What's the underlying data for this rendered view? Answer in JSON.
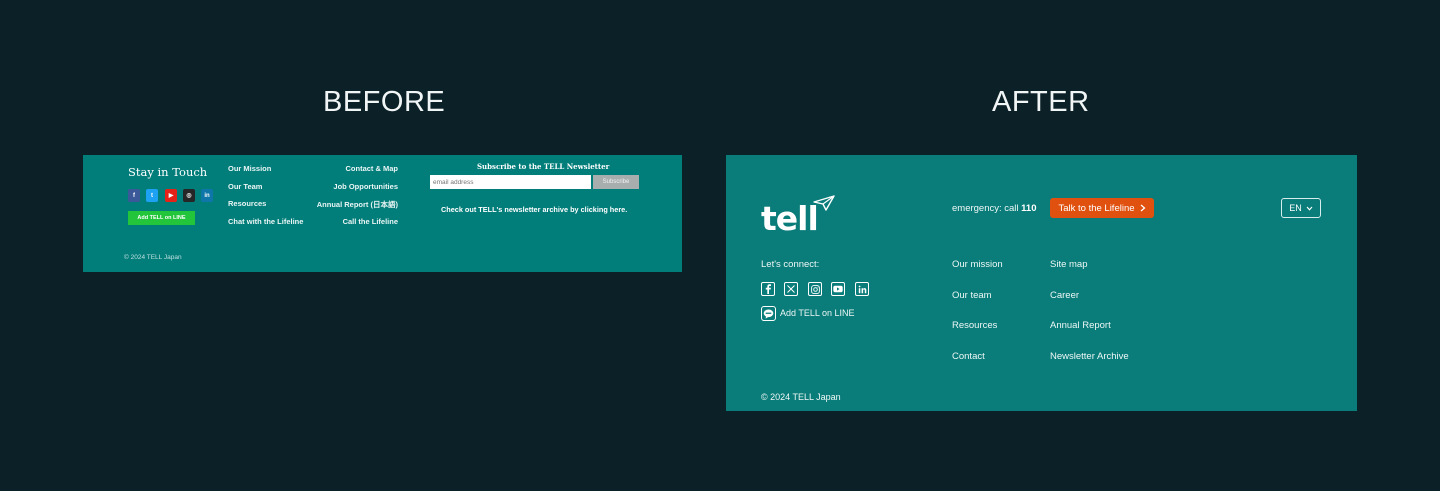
{
  "headings": {
    "before": "BEFORE",
    "after": "AFTER"
  },
  "before": {
    "stay_title": "Stay in Touch",
    "social_icons": [
      {
        "name": "facebook-icon",
        "glyph": "f",
        "color": "#3b5998"
      },
      {
        "name": "twitter-icon",
        "glyph": "t",
        "color": "#1da1f2"
      },
      {
        "name": "youtube-icon",
        "glyph": "▶",
        "color": "#e62117"
      },
      {
        "name": "instagram-icon",
        "glyph": "◎",
        "color": "#262626"
      },
      {
        "name": "linkedin-icon",
        "glyph": "in",
        "color": "#0e76a8"
      }
    ],
    "line_button": "Add TELL on LINE",
    "links_col1": [
      "Our Mission",
      "Our Team",
      "Resources",
      "Chat with the Lifeline"
    ],
    "links_col2": [
      "Contact & Map",
      "Job Opportunities",
      "Annual Report (日本語)",
      "Call the Lifeline"
    ],
    "newsletter_title": "Subscribe to the TELL Newsletter",
    "email_placeholder": "email address",
    "subscribe_button": "Subscribe",
    "archive_text": "Check out TELL's newsletter archive by clicking here.",
    "copyright": "© 2024 TELL Japan"
  },
  "after": {
    "logo_text": "tell",
    "emergency_prefix": "emergency: call",
    "emergency_number": "110",
    "talk_button": "Talk to the Lifeline",
    "language": "EN",
    "lets_connect": "Let's connect:",
    "social_icons": [
      "facebook-icon",
      "x-icon",
      "instagram-icon",
      "youtube-icon",
      "linkedin-icon"
    ],
    "line_text": "Add TELL on LINE",
    "links_col1": [
      "Our mission",
      "Our team",
      "Resources",
      "Contact"
    ],
    "links_col2": [
      "Site map",
      "Career",
      "Annual Report",
      "Newsletter Archive"
    ],
    "copyright": "© 2024 TELL Japan"
  },
  "colors": {
    "page_bg": "#0b2127",
    "before_footer_bg": "#017d7a",
    "after_footer_bg": "#0a7c79",
    "line_green": "#23c53a",
    "talk_button_orange": "#e0510f"
  }
}
